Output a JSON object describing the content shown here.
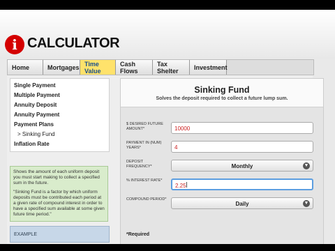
{
  "brand": {
    "logo_letter": "i",
    "name": "CALCULATOR"
  },
  "nav": {
    "tabs": [
      {
        "label": "Home"
      },
      {
        "label": "Mortgages"
      },
      {
        "label": "Time Value"
      },
      {
        "label": "Cash Flows"
      },
      {
        "label": "Tax Shelter"
      },
      {
        "label": "Investment"
      }
    ],
    "active": "Time Value"
  },
  "sidebar": {
    "items": [
      {
        "label": "Single Payment"
      },
      {
        "label": "Multiple Payment"
      },
      {
        "label": "Annuity Deposit"
      },
      {
        "label": "Annuity Payment"
      },
      {
        "label": "Payment Plans"
      },
      {
        "label": "> Sinking Fund"
      },
      {
        "label": "Inflation Rate"
      }
    ]
  },
  "info": {
    "p1": "Shows the amount of each uniform deposit you must start making to collect a specified sum in the future.",
    "p2": "\"Sinking Fund is a factor by which uniform deposits must be contributed each period at a given rate of compound interest in order to have a specified sum available at some given future time period.\""
  },
  "example_bar": {
    "label": "EXAMPLE"
  },
  "panel": {
    "title": "Sinking Fund",
    "subtitle": "Solves the deposit required to collect a future lump sum.",
    "fields": {
      "future_amount": {
        "label": "$ DESIRED FUTURE AMOUNT*",
        "value": "10000"
      },
      "payment_years": {
        "label": "PAYMENT IN (NUM) YEARS*",
        "value": "4"
      },
      "deposit_frequency": {
        "label": "DEPOSIT FREQUENCY*",
        "value": "Monthly"
      },
      "interest_rate": {
        "label": "% INTEREST RATE*",
        "value": "2.25"
      },
      "compound_period": {
        "label": "COMPOUND PERIOD*",
        "value": "Daily"
      }
    },
    "required_note": "*Required"
  },
  "colors": {
    "accent_red": "#d40000",
    "active_tab": "#ffe26b",
    "info_green": "#d9eccc",
    "focus_blue": "#5c9ee0"
  }
}
